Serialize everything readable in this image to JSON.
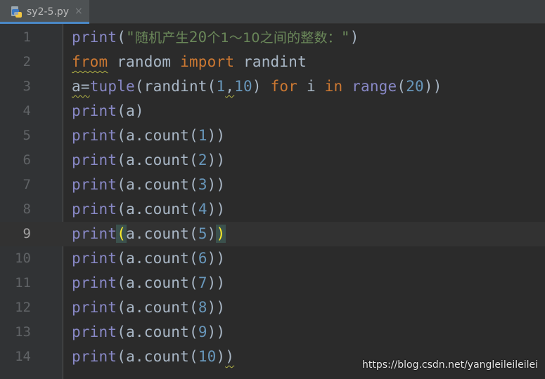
{
  "tab": {
    "filename": "sy2-5.py",
    "close_glyph": "×",
    "icon": "python-file-icon"
  },
  "editor": {
    "current_line": 9,
    "lines": [
      {
        "n": "1"
      },
      {
        "n": "2"
      },
      {
        "n": "3"
      },
      {
        "n": "4"
      },
      {
        "n": "5"
      },
      {
        "n": "6"
      },
      {
        "n": "7"
      },
      {
        "n": "8"
      },
      {
        "n": "9"
      },
      {
        "n": "10"
      },
      {
        "n": "11"
      },
      {
        "n": "12"
      },
      {
        "n": "13"
      },
      {
        "n": "14"
      }
    ],
    "tokens": {
      "print": "print",
      "from": "from",
      "random": "random",
      "import": "import",
      "randint": "randint",
      "a_eq": "a=",
      "tuple": "tuple",
      "for": "for",
      "i": "i",
      "in": "in",
      "range": "range",
      "a": "a",
      "a_count": "a.count",
      "lp": "(",
      "rp": ")",
      "comma": ",",
      "str_open": "\"",
      "str_cjk1": "随机产生",
      "str_num": "20",
      "str_cjk2": "个1～10之间的整数：",
      "str_close": "\"",
      "n1": "1",
      "n2": "2",
      "n3": "3",
      "n4": "4",
      "n5": "5",
      "n6": "6",
      "n7": "7",
      "n8": "8",
      "n9": "9",
      "n10": "10",
      "n20": "20"
    }
  },
  "watermark": "https://blog.csdn.net/yangleileileilei",
  "colors": {
    "background": "#2b2b2b",
    "keyword": "#cc7832",
    "builtin": "#8888c6",
    "number": "#6897bb",
    "string": "#6a8759",
    "text": "#a9b7c6",
    "brace_highlight": "#ffef28"
  }
}
